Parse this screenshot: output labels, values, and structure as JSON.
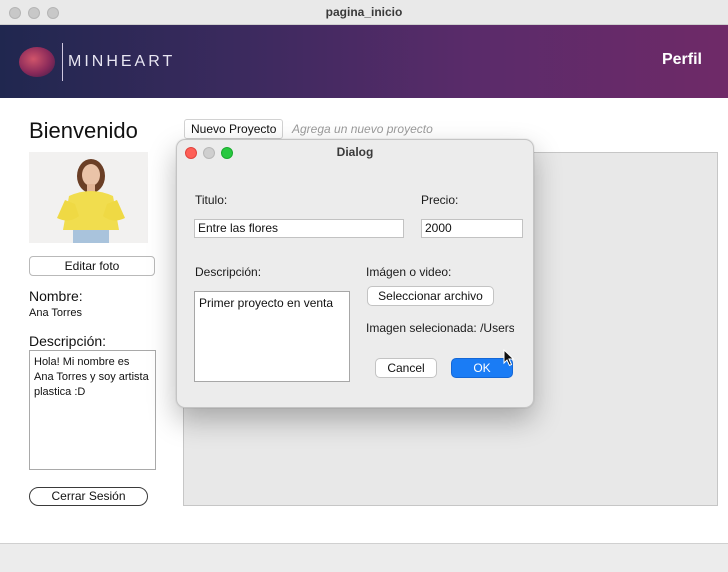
{
  "window": {
    "title": "pagina_inicio"
  },
  "header": {
    "brand": "MINHEART",
    "profile_label": "Perfil"
  },
  "sidebar": {
    "welcome": "Bienvenido",
    "edit_photo_label": "Editar foto",
    "name_label": "Nombre:",
    "name_value": "Ana Torres",
    "description_label": "Descripción:",
    "description_value": "Hola! Mi nombre es Ana Torres y soy artista plastica :D",
    "logout_label": "Cerrar Sesión"
  },
  "main": {
    "new_project_label": "Nuevo Proyecto",
    "new_project_hint": "Agrega un nuevo proyecto"
  },
  "dialog": {
    "title": "Dialog",
    "title_label": "Titulo:",
    "title_value": "Entre las flores",
    "price_label": "Precio:",
    "price_value": "2000",
    "description_label": "Descripción:",
    "description_value": "Primer proyecto en venta",
    "media_label": "Imágen o video:",
    "select_file_label": "Seleccionar archivo",
    "selected_image_text": "Imagen selecionada: /Users",
    "cancel_label": "Cancel",
    "ok_label": "OK"
  },
  "colors": {
    "header_start": "#20274f",
    "header_end": "#6f2a68",
    "ok_button": "#1a7cf5",
    "traffic_red": "#fe5f57",
    "traffic_green": "#28c840"
  },
  "icons": [
    "logo-mark",
    "close-icon",
    "minimize-icon",
    "zoom-icon",
    "pointer-cursor-icon"
  ]
}
